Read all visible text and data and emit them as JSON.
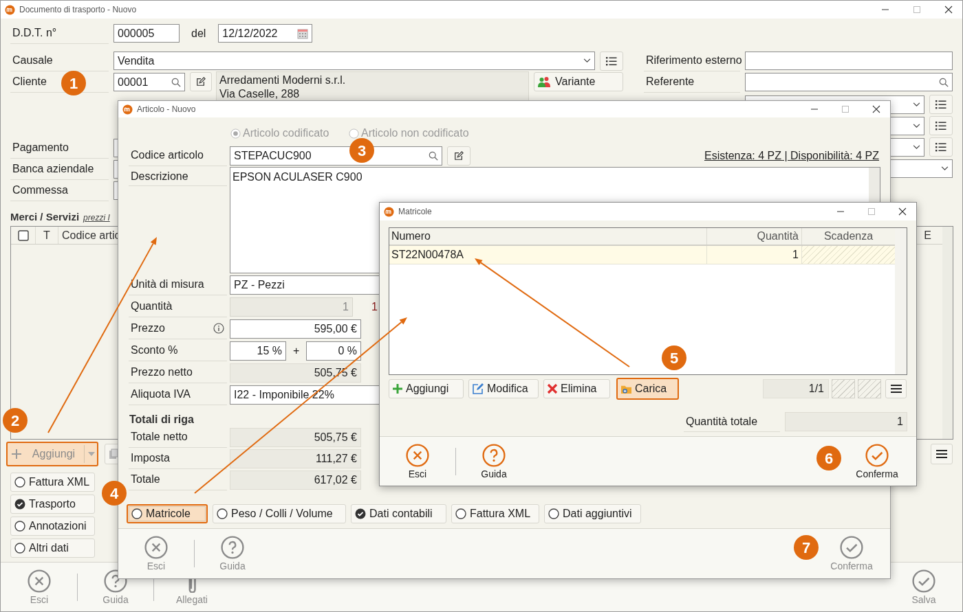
{
  "main_window": {
    "title": "Documento di trasporto - Nuovo",
    "ddt": {
      "label": "D.D.T. n°",
      "value": "000005",
      "date_label": "del",
      "date": "12/12/2022"
    },
    "causale": {
      "label": "Causale",
      "value": "Vendita"
    },
    "cliente": {
      "label": "Cliente",
      "code": "00001",
      "address_lines": [
        "Arredamenti Moderni s.r.l.",
        "Via Caselle, 288"
      ],
      "variant_button": "Variante"
    },
    "right_fields": [
      {
        "label": "Riferimento esterno",
        "kind": "text"
      },
      {
        "label": "Referente",
        "kind": "search"
      }
    ],
    "left_labels": [
      "Pagamento",
      "Banca aziendale",
      "Commessa"
    ],
    "section": {
      "title": "Merci / Servizi",
      "link": "prezzi I"
    },
    "table": {
      "columns": [
        "T",
        "Codice artic"
      ],
      "last_column": "E"
    },
    "add_button": {
      "label": "Aggiungi",
      "highlighted": true
    },
    "side_tabs": [
      {
        "label": "Fattura XML",
        "checked": false
      },
      {
        "label": "Trasporto",
        "checked": true
      },
      {
        "label": "Annotazioni",
        "checked": false
      },
      {
        "label": "Altri dati",
        "checked": false
      }
    ],
    "footer_buttons": [
      {
        "label": "Esci",
        "kind": "close",
        "disabled": true
      },
      {
        "label": "Guida",
        "kind": "help",
        "disabled": true
      },
      {
        "label": "Allegati",
        "kind": "attach",
        "disabled": true
      },
      {
        "label": "Salva",
        "kind": "confirm",
        "disabled": true
      }
    ]
  },
  "article_window": {
    "title": "Articolo - Nuovo",
    "type_options": [
      {
        "label": "Articolo codificato",
        "selected": true
      },
      {
        "label": "Articolo non codificato",
        "selected": false
      }
    ],
    "code": {
      "label": "Codice articolo",
      "value": "STEPACUC900"
    },
    "stock_link": "Esistenza: 4 PZ | Disponibilità: 4 PZ",
    "description": {
      "label": "Descrizione",
      "value": "EPSON ACULASER C900"
    },
    "rows": [
      {
        "label": "Unità di misura",
        "kind": "text",
        "value": "PZ - Pezzi",
        "info": false
      },
      {
        "label": "Quantità",
        "kind": "disabled",
        "value": "1",
        "side_value": "1",
        "info": false
      },
      {
        "label": "Prezzo",
        "kind": "money",
        "value": "595,00 €",
        "info": true
      },
      {
        "label": "Sconto %",
        "kind": "discount",
        "value": "15 %",
        "joiner": "+",
        "second_value": "0 %",
        "info": false
      },
      {
        "label": "Prezzo netto",
        "kind": "readonly",
        "value": "505,75 €",
        "info": false
      },
      {
        "label": "Aliquota IVA",
        "kind": "text",
        "value": "I22 - Imponibile 22%",
        "info": false
      }
    ],
    "totals_title": "Totali di riga",
    "totals": [
      {
        "label": "Totale netto",
        "value": "505,75 €"
      },
      {
        "label": "Imposta",
        "value": "111,27 €"
      },
      {
        "label": "Totale",
        "value": "617,02 €"
      }
    ],
    "tabs": [
      {
        "label": "Matricole",
        "checked": false,
        "highlighted": true
      },
      {
        "label": "Peso / Colli / Volume",
        "checked": false,
        "highlighted": false
      },
      {
        "label": "Dati contabili",
        "checked": true,
        "highlighted": false
      },
      {
        "label": "Fattura XML",
        "checked": false,
        "highlighted": false
      },
      {
        "label": "Dati aggiuntivi",
        "checked": false,
        "highlighted": false
      }
    ],
    "footer_buttons": [
      {
        "label": "Esci",
        "kind": "close",
        "disabled": true
      },
      {
        "label": "Guida",
        "kind": "help",
        "disabled": true
      },
      {
        "label": "Conferma",
        "kind": "confirm",
        "disabled": true
      }
    ]
  },
  "matricole_window": {
    "title": "Matricole",
    "columns": [
      "Numero",
      "Quantità",
      "Scadenza"
    ],
    "rows": [
      {
        "numero": "ST22N00478A",
        "quantita": "1",
        "selected": true
      }
    ],
    "buttons": [
      {
        "label": "Aggiungi",
        "kind": "add",
        "highlighted": false
      },
      {
        "label": "Modifica",
        "kind": "edit",
        "highlighted": false
      },
      {
        "label": "Elimina",
        "kind": "delete",
        "highlighted": false
      },
      {
        "label": "Carica",
        "kind": "load",
        "highlighted": true
      }
    ],
    "pager": "1/1",
    "total": {
      "label": "Quantità totale",
      "value": "1"
    },
    "footer_buttons": [
      {
        "label": "Esci",
        "kind": "close",
        "disabled": false
      },
      {
        "label": "Guida",
        "kind": "help",
        "disabled": false
      },
      {
        "label": "Conferma",
        "kind": "confirm",
        "disabled": false
      }
    ]
  },
  "callouts": [
    {
      "number": "1"
    },
    {
      "number": "2"
    },
    {
      "number": "3"
    },
    {
      "number": "4"
    },
    {
      "number": "5"
    },
    {
      "number": "6"
    },
    {
      "number": "7"
    }
  ]
}
